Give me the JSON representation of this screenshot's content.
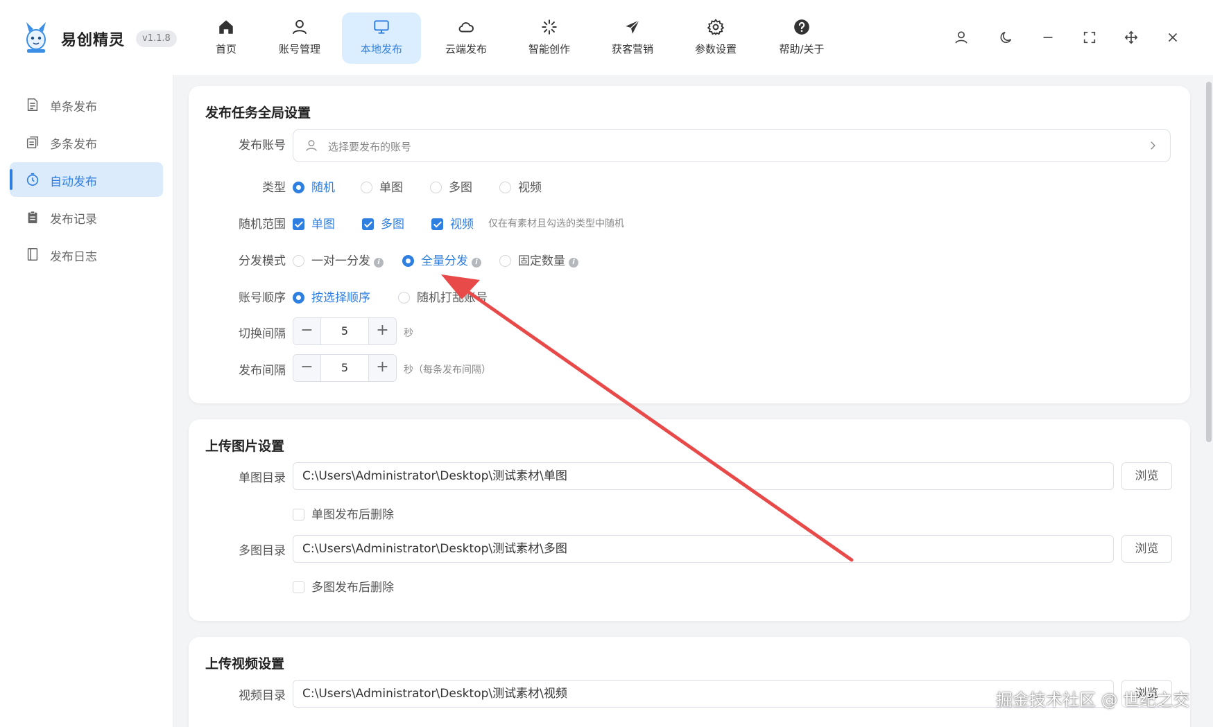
{
  "app": {
    "name": "易创精灵",
    "version": "v1.1.8"
  },
  "nav": [
    {
      "label": "首页",
      "icon": "home-icon"
    },
    {
      "label": "账号管理",
      "icon": "user-icon"
    },
    {
      "label": "本地发布",
      "icon": "monitor-icon",
      "active": true
    },
    {
      "label": "云端发布",
      "icon": "cloud-icon"
    },
    {
      "label": "智能创作",
      "icon": "sparkle-icon"
    },
    {
      "label": "获客营销",
      "icon": "paper-plane-icon"
    },
    {
      "label": "参数设置",
      "icon": "gear-icon"
    },
    {
      "label": "帮助/关于",
      "icon": "question-icon"
    }
  ],
  "window_controls": [
    "user-icon",
    "moon-icon",
    "minimize-icon",
    "fullscreen-icon",
    "move-icon",
    "close-icon"
  ],
  "sidebar": [
    {
      "label": "单条发布",
      "icon": "document-icon"
    },
    {
      "label": "多条发布",
      "icon": "copy-icon"
    },
    {
      "label": "自动发布",
      "icon": "timer-icon",
      "active": true
    },
    {
      "label": "发布记录",
      "icon": "clipboard-icon"
    },
    {
      "label": "发布日志",
      "icon": "book-icon"
    }
  ],
  "global": {
    "title": "发布任务全局设置",
    "account_label": "发布账号",
    "account_placeholder": "选择要发布的账号",
    "type_label": "类型",
    "type_options": [
      "随机",
      "单图",
      "多图",
      "视频"
    ],
    "range_label": "随机范围",
    "range_options": [
      "单图",
      "多图",
      "视频"
    ],
    "range_hint": "仅在有素材且勾选的类型中随机",
    "mode_label": "分发模式",
    "mode_options": [
      "一对一分发",
      "全量分发",
      "固定数量"
    ],
    "order_label": "账号顺序",
    "order_options": [
      "按选择顺序",
      "随机打乱账号"
    ],
    "switch_label": "切换间隔",
    "switch_value": "5",
    "switch_unit": "秒",
    "publish_label": "发布间隔",
    "publish_value": "5",
    "publish_unit": "秒（每条发布间隔）"
  },
  "image": {
    "title": "上传图片设置",
    "single_label": "单图目录",
    "single_path": "C:\\Users\\Administrator\\Desktop\\测试素材\\单图",
    "single_delete": "单图发布后删除",
    "multi_label": "多图目录",
    "multi_path": "C:\\Users\\Administrator\\Desktop\\测试素材\\多图",
    "multi_delete": "多图发布后删除",
    "browse": "浏览"
  },
  "video": {
    "title": "上传视频设置",
    "dir_label": "视频目录",
    "dir_path": "C:\\Users\\Administrator\\Desktop\\测试素材\\视频",
    "browse": "浏览"
  },
  "watermark": "掘金技术社区 @ 世纪之交",
  "colors": {
    "accent": "#2f7fe0",
    "arrow": "#e84a4a"
  }
}
